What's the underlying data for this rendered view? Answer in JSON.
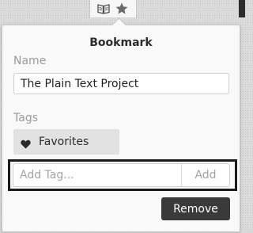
{
  "toolbar": {
    "icons": [
      "reader-view-icon",
      "bookmark-star-icon"
    ],
    "star_color": "#6a6a6a"
  },
  "popup": {
    "title": "Bookmark",
    "name_label": "Name",
    "name_value": "The Plain Text Project",
    "tags_label": "Tags",
    "tags": [
      {
        "label": "Favorites",
        "icon": "heart-icon"
      }
    ],
    "add_tag_placeholder": "Add Tag...",
    "add_tag_button": "Add",
    "remove_button": "Remove"
  },
  "colors": {
    "panel_background": "#f9f9f9",
    "tag_chip_background": "#e2e2e2",
    "remove_button_background": "#3a3a3a",
    "highlight_frame": "#1a1a1a"
  }
}
